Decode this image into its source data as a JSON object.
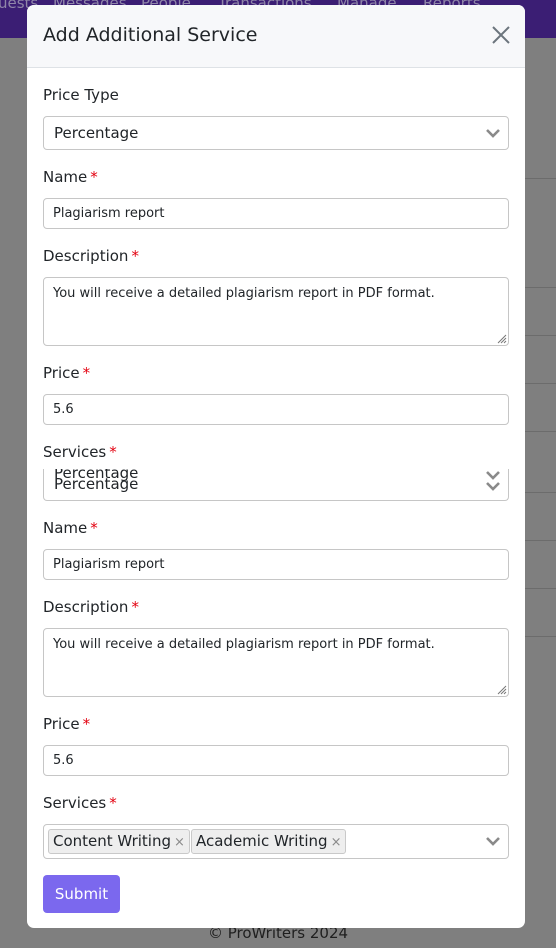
{
  "background": {
    "nav_items": [
      "uests",
      "Messages",
      "People",
      "Transactions",
      "Manage",
      "Reports"
    ],
    "footer": "© ProWriters 2024"
  },
  "modal": {
    "title": "Add Additional Service",
    "close_icon": "close-icon",
    "form_first": {
      "price_type": {
        "label": "Price Type",
        "value": "Percentage"
      },
      "name": {
        "label": "Name",
        "required": "*",
        "value": "Plagiarism report"
      },
      "description": {
        "label": "Description",
        "required": "*",
        "value": "You will receive a detailed plagiarism report in PDF format."
      },
      "price": {
        "label": "Price",
        "required": "*",
        "value": "5.6"
      },
      "services": {
        "label": "Services",
        "required": "*",
        "ghost_value": "Percentage",
        "value": "Percentage"
      }
    },
    "form_second": {
      "name": {
        "label": "Name",
        "required": "*",
        "value": "Plagiarism report"
      },
      "description": {
        "label": "Description",
        "required": "*",
        "value": "You will receive a detailed plagiarism report in PDF format."
      },
      "price": {
        "label": "Price",
        "required": "*",
        "value": "5.6"
      },
      "services": {
        "label": "Services",
        "required": "*",
        "selected": [
          {
            "label": "Content Writing",
            "remove": "×"
          },
          {
            "label": "Academic Writing",
            "remove": "×"
          }
        ]
      }
    },
    "submit_label": "Submit"
  },
  "colors": {
    "navbar": "#3b1e74",
    "primary_button": "#7b68ee",
    "required_marker": "#e3000f",
    "overlay": "#7f7f7f"
  }
}
